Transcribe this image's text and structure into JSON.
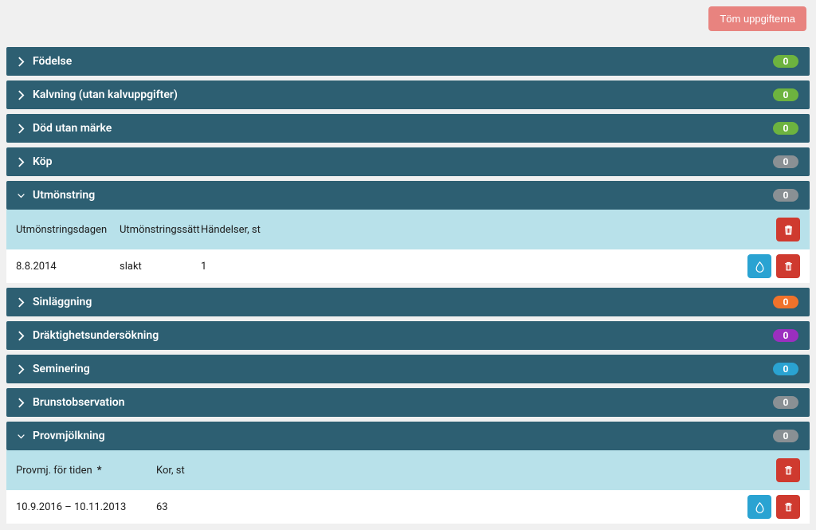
{
  "actions": {
    "clear_label": "Töm uppgifterna"
  },
  "panels": {
    "fodelse": {
      "label": "Födelse",
      "count": "0",
      "badge_class": "badge-green"
    },
    "kalvning": {
      "label": "Kalvning (utan kalvuppgifter)",
      "count": "0",
      "badge_class": "badge-green"
    },
    "dod": {
      "label": "Död utan märke",
      "count": "0",
      "badge_class": "badge-green"
    },
    "kop": {
      "label": "Köp",
      "count": "0",
      "badge_class": "badge-grey"
    },
    "utmonstring": {
      "label": "Utmönstring",
      "count": "0",
      "badge_class": "badge-grey",
      "columns": {
        "date": "Utmönstringsdagen",
        "method": "Utmönstringssätt",
        "events": "Händelser, st"
      },
      "row": {
        "date": "8.8.2014",
        "method": "slakt",
        "events": "1"
      }
    },
    "sinlaggning": {
      "label": "Sinläggning",
      "count": "0",
      "badge_class": "badge-orange"
    },
    "draktighet": {
      "label": "Dräktighetsundersökning",
      "count": "0",
      "badge_class": "badge-purple"
    },
    "seminering": {
      "label": "Seminering",
      "count": "0",
      "badge_class": "badge-blue"
    },
    "brunst": {
      "label": "Brunstobservation",
      "count": "0",
      "badge_class": "badge-grey"
    },
    "provmjolkning": {
      "label": "Provmjölkning",
      "count": "0",
      "badge_class": "badge-grey",
      "columns": {
        "period": "Provmj. för tiden",
        "cows": "Kor, st"
      },
      "row": {
        "period": "10.9.2016 – 10.11.2013",
        "cows": "63"
      }
    }
  }
}
